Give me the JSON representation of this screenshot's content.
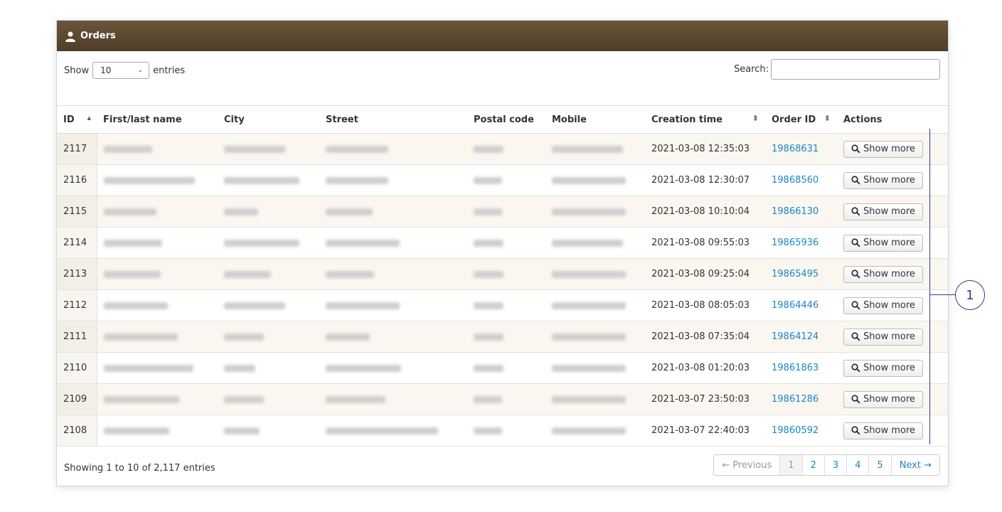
{
  "header": {
    "title": "Orders",
    "icon": "user-icon"
  },
  "length": {
    "show_label": "Show",
    "value": "10",
    "entries_label": "entries"
  },
  "search": {
    "label": "Search:",
    "value": ""
  },
  "columns": [
    "ID",
    "First/last name",
    "City",
    "Street",
    "Postal code",
    "Mobile",
    "Creation time",
    "Order ID",
    "Actions"
  ],
  "rows": [
    {
      "id": "2117",
      "created": "2021-03-08 12:35:03",
      "order_id": "19868631"
    },
    {
      "id": "2116",
      "created": "2021-03-08 12:30:07",
      "order_id": "19868560"
    },
    {
      "id": "2115",
      "created": "2021-03-08 10:10:04",
      "order_id": "19866130"
    },
    {
      "id": "2114",
      "created": "2021-03-08 09:55:03",
      "order_id": "19865936"
    },
    {
      "id": "2113",
      "created": "2021-03-08 09:25:04",
      "order_id": "19865495"
    },
    {
      "id": "2112",
      "created": "2021-03-08 08:05:03",
      "order_id": "19864446"
    },
    {
      "id": "2111",
      "created": "2021-03-08 07:35:04",
      "order_id": "19864124"
    },
    {
      "id": "2110",
      "created": "2021-03-08 01:20:03",
      "order_id": "19861863"
    },
    {
      "id": "2109",
      "created": "2021-03-07 23:50:03",
      "order_id": "19861286"
    },
    {
      "id": "2108",
      "created": "2021-03-07 22:40:03",
      "order_id": "19860592"
    }
  ],
  "action_label": "Show more",
  "footer": {
    "info": "Showing 1 to 10 of 2,117 entries"
  },
  "pagination": {
    "previous": "← Previous",
    "pages": [
      "1",
      "2",
      "3",
      "4",
      "5"
    ],
    "next": "Next →"
  },
  "callout": {
    "number": "1"
  },
  "colors": {
    "header": "#5b4731",
    "link": "#1a85c8",
    "callout": "#2c3e7a"
  }
}
